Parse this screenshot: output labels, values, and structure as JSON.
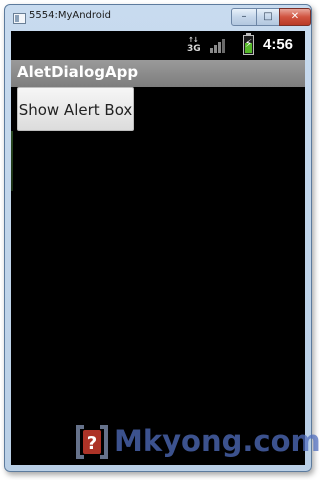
{
  "window": {
    "title": "5554:MyAndroid",
    "minimize_glyph": "–",
    "maximize_glyph": "□",
    "close_glyph": "✕"
  },
  "statusbar": {
    "network_type": "3G",
    "network_arrows": "↑↓",
    "battery_glyph": "⚡",
    "battery_level": 0.65,
    "time": "4:56",
    "battery_color": "#56b82a"
  },
  "app": {
    "title": "AletDialogApp",
    "button_label": "Show Alert Box"
  },
  "watermark": {
    "text": "Mkyong.com",
    "logo_glyph": "?"
  },
  "colors": {
    "screen_bg": "#000000",
    "appbar": "#8a8a8a",
    "logo_red": "#c0392b"
  }
}
